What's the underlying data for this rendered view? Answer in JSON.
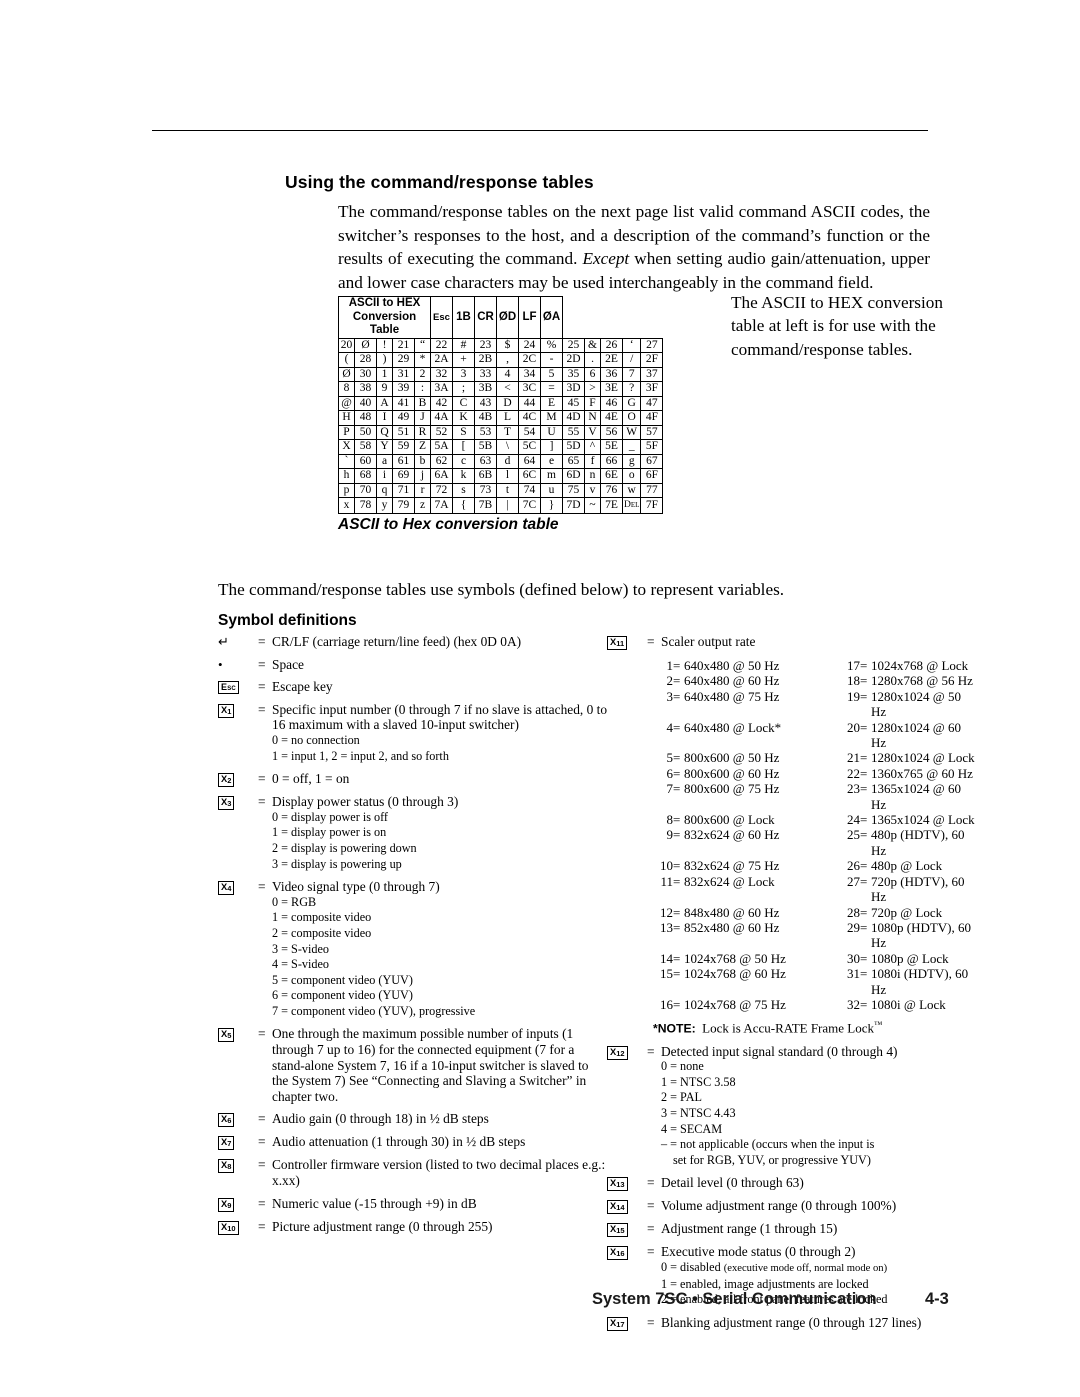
{
  "section": {
    "title": "Using the command/response tables",
    "intro": "The command/response tables on the next page list valid command ASCII codes, the switcher’s responses to the host, and a description of the command’s function or the results of executing the command. <i>Except</i> when setting audio gain/attenuation, upper and lower case characters may be used interchangeably in the command field."
  },
  "ascii_table": {
    "header": "ASCII to HEX  Conversion Table",
    "header_specials": [
      {
        "label": "Esc",
        "hex": "1B"
      },
      {
        "label": "CR",
        "hex": "ØD"
      },
      {
        "label": "LF",
        "hex": "ØA"
      }
    ],
    "rows": [
      [
        [
          "20",
          "Ø"
        ],
        [
          "!",
          "21"
        ],
        [
          "“",
          "22"
        ],
        [
          "#",
          "23"
        ],
        [
          "$",
          "24"
        ],
        [
          "%",
          "25"
        ],
        [
          "&",
          "26"
        ],
        [
          "‘",
          "27"
        ]
      ],
      [
        [
          "(",
          "28"
        ],
        [
          ")",
          "29"
        ],
        [
          "*",
          "2A"
        ],
        [
          "+",
          "2B"
        ],
        [
          ",",
          "2C"
        ],
        [
          "-",
          "2D"
        ],
        [
          ".",
          "2E"
        ],
        [
          "/",
          "2F"
        ]
      ],
      [
        [
          "Ø",
          "30"
        ],
        [
          "1",
          "31"
        ],
        [
          "2",
          "32"
        ],
        [
          "3",
          "33"
        ],
        [
          "4",
          "34"
        ],
        [
          "5",
          "35"
        ],
        [
          "6",
          "36"
        ],
        [
          "7",
          "37"
        ]
      ],
      [
        [
          "8",
          "38"
        ],
        [
          "9",
          "39"
        ],
        [
          ":",
          "3A"
        ],
        [
          ";",
          "3B"
        ],
        [
          "<",
          "3C"
        ],
        [
          "=",
          "3D"
        ],
        [
          ">",
          "3E"
        ],
        [
          "?",
          "3F"
        ]
      ],
      [
        [
          "@",
          "40"
        ],
        [
          "A",
          "41"
        ],
        [
          "B",
          "42"
        ],
        [
          "C",
          "43"
        ],
        [
          "D",
          "44"
        ],
        [
          "E",
          "45"
        ],
        [
          "F",
          "46"
        ],
        [
          "G",
          "47"
        ]
      ],
      [
        [
          "H",
          "48"
        ],
        [
          "I",
          "49"
        ],
        [
          "J",
          "4A"
        ],
        [
          "K",
          "4B"
        ],
        [
          "L",
          "4C"
        ],
        [
          "M",
          "4D"
        ],
        [
          "N",
          "4E"
        ],
        [
          "O",
          "4F"
        ]
      ],
      [
        [
          "P",
          "50"
        ],
        [
          "Q",
          "51"
        ],
        [
          "R",
          "52"
        ],
        [
          "S",
          "53"
        ],
        [
          "T",
          "54"
        ],
        [
          "U",
          "55"
        ],
        [
          "V",
          "56"
        ],
        [
          "W",
          "57"
        ]
      ],
      [
        [
          "X",
          "58"
        ],
        [
          "Y",
          "59"
        ],
        [
          "Z",
          "5A"
        ],
        [
          "[",
          "5B"
        ],
        [
          "\\",
          "5C"
        ],
        [
          "]",
          "5D"
        ],
        [
          "^",
          "5E"
        ],
        [
          "_",
          "5F"
        ]
      ],
      [
        [
          "`",
          "60"
        ],
        [
          "a",
          "61"
        ],
        [
          "b",
          "62"
        ],
        [
          "c",
          "63"
        ],
        [
          "d",
          "64"
        ],
        [
          "e",
          "65"
        ],
        [
          "f",
          "66"
        ],
        [
          "g",
          "67"
        ]
      ],
      [
        [
          "h",
          "68"
        ],
        [
          "i",
          "69"
        ],
        [
          "j",
          "6A"
        ],
        [
          "k",
          "6B"
        ],
        [
          "l",
          "6C"
        ],
        [
          "m",
          "6D"
        ],
        [
          "n",
          "6E"
        ],
        [
          "o",
          "6F"
        ]
      ],
      [
        [
          "p",
          "70"
        ],
        [
          "q",
          "71"
        ],
        [
          "r",
          "72"
        ],
        [
          "s",
          "73"
        ],
        [
          "t",
          "74"
        ],
        [
          "u",
          "75"
        ],
        [
          "v",
          "76"
        ],
        [
          "w",
          "77"
        ]
      ],
      [
        [
          "x",
          "78"
        ],
        [
          "y",
          "79"
        ],
        [
          "z",
          "7A"
        ],
        [
          "{",
          "7B"
        ],
        [
          "|",
          "7C"
        ],
        [
          "}",
          "7D"
        ],
        [
          "~",
          "7E"
        ],
        [
          "DEL",
          "7F"
        ]
      ]
    ],
    "first_cell_label": "20",
    "first_cell_char": "Ø"
  },
  "aside": "The ASCII to HEX conversion table at left is for use with the command/response tables.",
  "caption": "ASCII to Hex conversion table",
  "para2": "The command/response tables use symbols (defined below) to represent variables.",
  "symbol_heading": "Symbol definitions",
  "symbols_left": [
    {
      "sym": "↵",
      "symtype": "glyph",
      "eq": "=",
      "text": "CR/LF (carriage return/line feed) (hex 0D 0A)"
    },
    {
      "sym": "•",
      "symtype": "glyph",
      "eq": "=",
      "text": "Space"
    },
    {
      "sym": "Esc",
      "symtype": "esc",
      "eq": "=",
      "text": "Escape key"
    },
    {
      "sym": "X1",
      "symtype": "box",
      "eq": "=",
      "text": "Specific input number (0 through 7 if no slave is attached, 0 to 16 maximum with a slaved 10-input switcher)",
      "sublines": [
        "0 = no connection",
        "1 = input 1,  2 = input 2, and so forth"
      ]
    },
    {
      "sym": "X2",
      "symtype": "box",
      "eq": "=",
      "text": "0 = off, 1 = on"
    },
    {
      "sym": "X3",
      "symtype": "box",
      "eq": "=",
      "text": "Display power status (0 through 3)",
      "sublines": [
        "0 = display power is off",
        "1 = display power is on",
        "2 = display is powering down",
        "3 = display is powering up"
      ]
    },
    {
      "sym": "X4",
      "symtype": "box",
      "eq": "=",
      "text": "Video signal type (0 through 7)",
      "sublines": [
        "0 = RGB",
        "1 = composite video",
        "2 = composite video",
        "3 = S-video",
        "4 = S-video",
        "5 = component video (YUV)",
        "6 = component video (YUV)",
        "7 = component video (YUV), progressive"
      ]
    },
    {
      "sym": "X5",
      "symtype": "box",
      "eq": "=",
      "text": "One through the maximum possible number of inputs (1 through 7 up to 16) for the connected equipment (7 for a stand-alone System 7, 16 if a 10-input switcher is slaved to the System 7) See “Connecting and Slaving a Switcher” in chapter two."
    },
    {
      "sym": "X6",
      "symtype": "box",
      "eq": "=",
      "text": "Audio gain (0 through 18) in ½ dB steps"
    },
    {
      "sym": "X7",
      "symtype": "box",
      "eq": "=",
      "text": "Audio attenuation (1 through 30) in ½ dB steps"
    },
    {
      "sym": "X8",
      "symtype": "box",
      "eq": "=",
      "text": "Controller firmware version (listed to two decimal places e.g.: x.xx)"
    },
    {
      "sym": "X9",
      "symtype": "box",
      "eq": "=",
      "text": "Numeric value  (-15 through +9) in dB"
    },
    {
      "sym": "X10",
      "symtype": "box",
      "eq": "=",
      "text": "Picture adjustment range (0 through 255)"
    }
  ],
  "symbols_right": [
    {
      "sym": "X11",
      "symtype": "box",
      "eq": "=",
      "text": "Scaler output rate"
    },
    {
      "sym": "X12",
      "symtype": "box",
      "eq": "=",
      "text": "Detected input signal standard (0 through 4)",
      "sublines": [
        "0 = none",
        "1 = NTSC 3.58",
        "2 = PAL",
        "3 = NTSC 4.43",
        "4 = SECAM",
        "– = not applicable (occurs when the input is",
        "set for RGB, YUV, or progressive YUV)"
      ]
    },
    {
      "sym": "X13",
      "symtype": "box",
      "eq": "=",
      "text": "Detail level (0 through 63)"
    },
    {
      "sym": "X14",
      "symtype": "box",
      "eq": "=",
      "text": "Volume adjustment range (0 through 100%)"
    },
    {
      "sym": "X15",
      "symtype": "box",
      "eq": "=",
      "text": "Adjustment range (1 through 15)"
    },
    {
      "sym": "X16",
      "symtype": "box",
      "eq": "=",
      "text": "Executive mode status (0 through 2)",
      "sublines": [
        "0 = disabled (executive mode off, normal mode on)",
        "1 = enabled, image adjustments are locked",
        "2 = enabled, all front panel features are locked"
      ]
    },
    {
      "sym": "X17",
      "symtype": "box",
      "eq": "=",
      "text": "Blanking adjustment range (0 through 127 lines)"
    }
  ],
  "scaler_rates_col1": [
    {
      "n": "1",
      "v": "640x480 @ 50 Hz"
    },
    {
      "n": "2",
      "v": "640x480 @ 60 Hz"
    },
    {
      "n": "3",
      "v": "640x480 @ 75 Hz"
    },
    {
      "n": "4",
      "v": "640x480 @ Lock*"
    },
    {
      "n": "5",
      "v": "800x600 @ 50 Hz"
    },
    {
      "n": "6",
      "v": "800x600 @ 60 Hz"
    },
    {
      "n": "7",
      "v": "800x600 @ 75 Hz"
    },
    {
      "n": "8",
      "v": "800x600 @ Lock"
    },
    {
      "n": "9",
      "v": "832x624 @ 60 Hz"
    },
    {
      "n": "10",
      "v": "832x624 @ 75 Hz"
    },
    {
      "n": "11",
      "v": "832x624 @ Lock"
    },
    {
      "n": "12",
      "v": "848x480 @ 60 Hz"
    },
    {
      "n": "13",
      "v": "852x480 @ 60 Hz"
    },
    {
      "n": "14",
      "v": "1024x768 @ 50 Hz"
    },
    {
      "n": "15",
      "v": "1024x768 @ 60 Hz"
    },
    {
      "n": "16",
      "v": "1024x768 @ 75 Hz"
    }
  ],
  "scaler_rates_col2": [
    {
      "n": "17",
      "v": "1024x768 @ Lock"
    },
    {
      "n": "18",
      "v": "1280x768 @ 56 Hz"
    },
    {
      "n": "19",
      "v": "1280x1024 @ 50 Hz"
    },
    {
      "n": "20",
      "v": "1280x1024 @ 60 Hz"
    },
    {
      "n": "21",
      "v": "1280x1024 @ Lock"
    },
    {
      "n": "22",
      "v": "1360x765 @ 60 Hz"
    },
    {
      "n": "23",
      "v": "1365x1024 @ 60 Hz"
    },
    {
      "n": "24",
      "v": "1365x1024 @ Lock"
    },
    {
      "n": "25",
      "v": "480p (HDTV), 60 Hz"
    },
    {
      "n": "26",
      "v": "480p @ Lock"
    },
    {
      "n": "27",
      "v": "720p (HDTV), 60 Hz"
    },
    {
      "n": "28",
      "v": "720p @ Lock"
    },
    {
      "n": "29",
      "v": "1080p (HDTV), 60 Hz"
    },
    {
      "n": "30",
      "v": "1080p @ Lock"
    },
    {
      "n": "31",
      "v": "1080i (HDTV), 60 Hz"
    },
    {
      "n": "32",
      "v": "1080i @ Lock"
    }
  ],
  "note": {
    "label": "*NOTE:",
    "text": "Lock is Accu-RATE Frame Lock",
    "tm": "™"
  },
  "footer": {
    "title": "System 7SC • Serial Communication",
    "page": "4-3"
  }
}
